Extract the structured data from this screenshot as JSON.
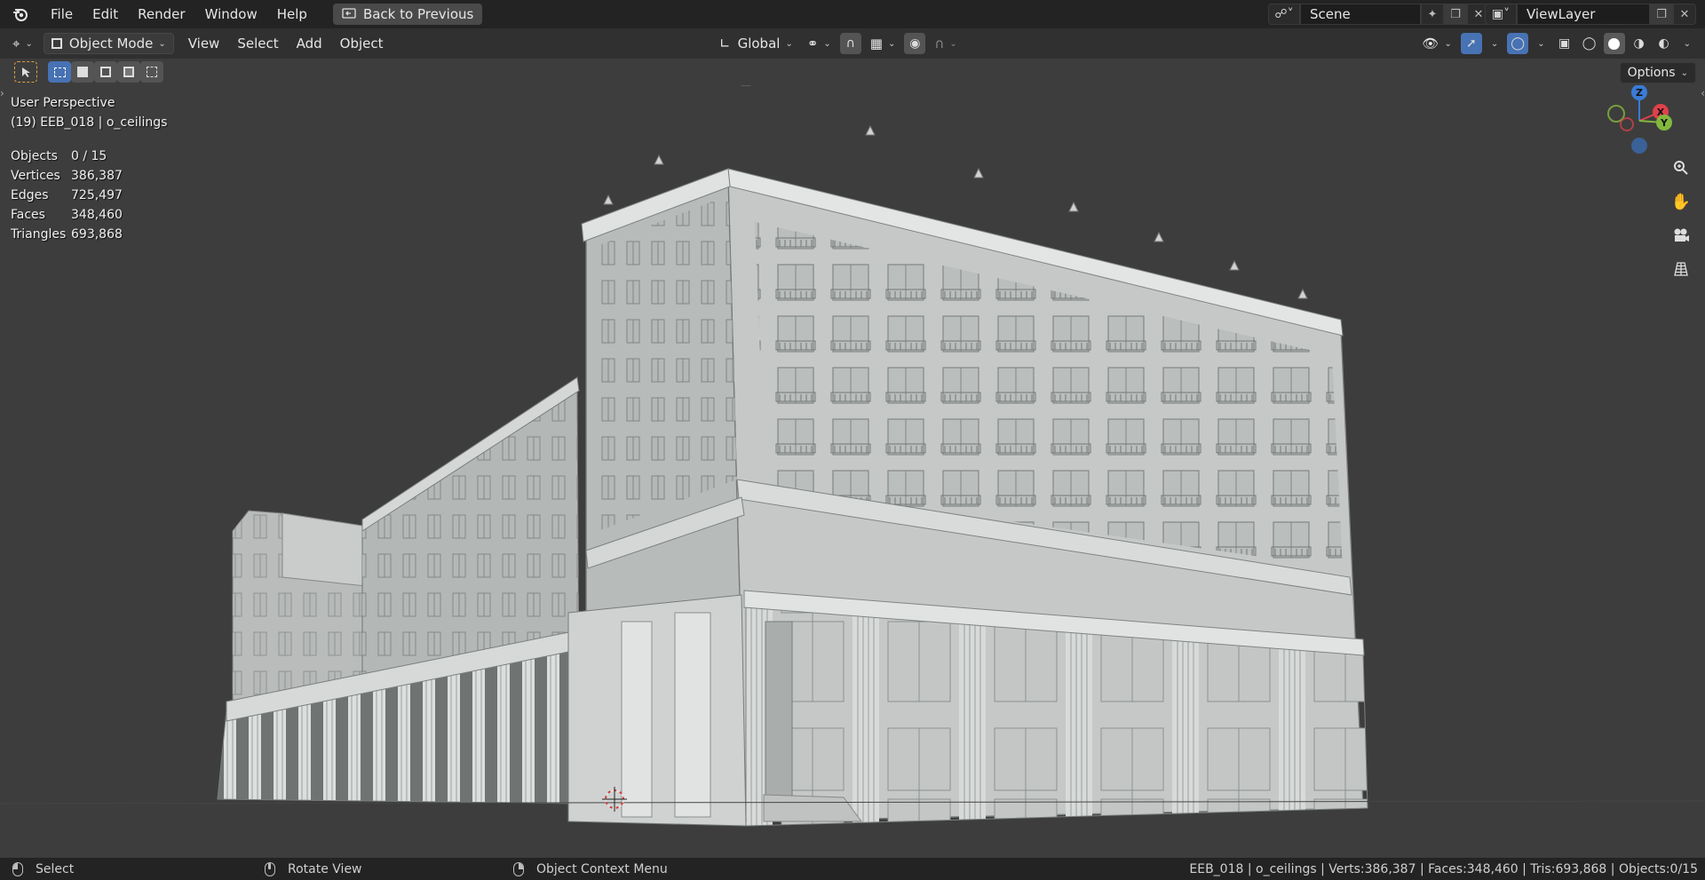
{
  "topbar": {
    "menus": [
      "File",
      "Edit",
      "Render",
      "Window",
      "Help"
    ],
    "back_button": "Back to Previous",
    "scene_name": "Scene",
    "view_layer": "ViewLayer"
  },
  "header": {
    "mode": "Object Mode",
    "menus": [
      "View",
      "Select",
      "Add",
      "Object"
    ],
    "transform_orientation": "Global"
  },
  "viewport": {
    "perspective": "User Perspective",
    "active_object": "(19) EEB_018 | o_ceilings",
    "stats": [
      {
        "label": "Objects",
        "value": "0 / 15"
      },
      {
        "label": "Vertices",
        "value": "386,387"
      },
      {
        "label": "Edges",
        "value": "725,497"
      },
      {
        "label": "Faces",
        "value": "348,460"
      },
      {
        "label": "Triangles",
        "value": "693,868"
      }
    ],
    "options_label": "Options",
    "gizmo": {
      "z": "Z",
      "x": "X",
      "y": "Y"
    }
  },
  "statusbar": {
    "left_click": "Select",
    "middle_click": "Rotate View",
    "right_click": "Object Context Menu",
    "info": "EEB_018 | o_ceilings | Verts:386,387 | Faces:348,460 | Tris:693,868 | Objects:0/15"
  },
  "colors": {
    "accent": "#4772b3",
    "axis_x": "#e0414b",
    "axis_y": "#82b83d",
    "axis_z": "#3a7bd5"
  }
}
